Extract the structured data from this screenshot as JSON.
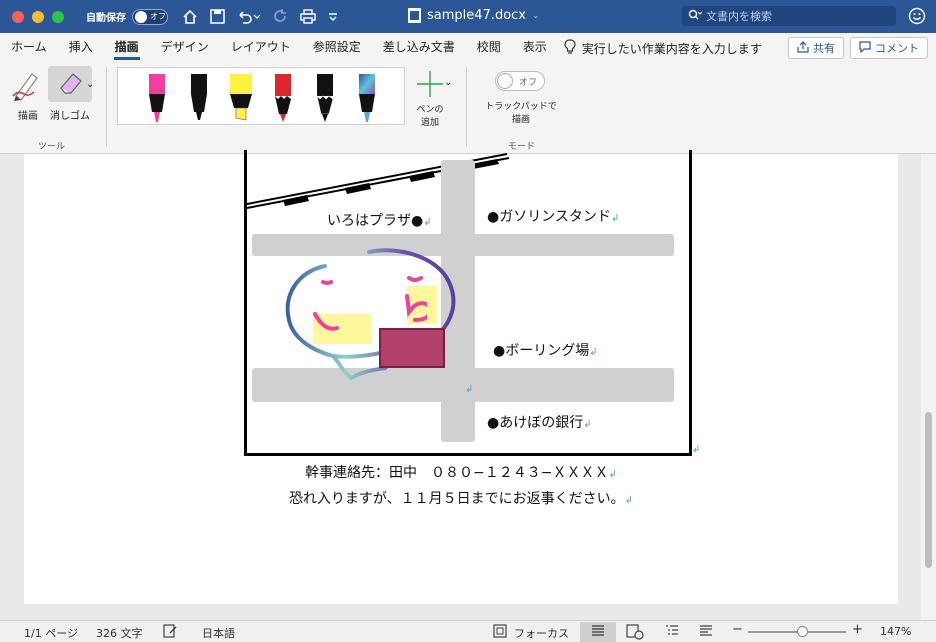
{
  "titlebar": {
    "autosave_label": "自動保存",
    "autosave_state": "オフ",
    "doc_name": "sample47.docx",
    "search_placeholder": "文書内を検索"
  },
  "tabs": [
    {
      "label": "ホーム"
    },
    {
      "label": "挿入"
    },
    {
      "label": "描画"
    },
    {
      "label": "デザイン"
    },
    {
      "label": "レイアウト"
    },
    {
      "label": "参照設定"
    },
    {
      "label": "差し込み文書"
    },
    {
      "label": "校閲"
    },
    {
      "label": "表示"
    }
  ],
  "tell_me": "実行したい作業内容を入力します",
  "share_label": "共有",
  "comment_label": "コメント",
  "ribbon": {
    "draw_label": "描画",
    "eraser_label": "消しゴム",
    "tools_group": "ツール",
    "add_pen_label1": "ペンの",
    "add_pen_label2": "追加",
    "mode_switch": "オフ",
    "mode_label1": "トラックパッドで",
    "mode_label2": "描画",
    "mode_group": "モード"
  },
  "pens": [
    {
      "color": "#f23ea0"
    },
    {
      "color": "#111111"
    },
    {
      "color": "#fff23c"
    },
    {
      "color": "#e0262d"
    },
    {
      "color": "#111111"
    },
    {
      "color": "#5aa7d6"
    }
  ],
  "map": {
    "place1": "いろはプラザ●",
    "place2": "●ガソリンスタンド",
    "place3": "●ボーリング場",
    "place4": "●あけぼの銀行",
    "return_mark": "↲"
  },
  "doc": {
    "line1": "幹事連絡先：田中　０８０−１２４３−ＸＸＸＸ",
    "line2": "恐れ入りますが、１１月５日までにお返事ください。"
  },
  "status": {
    "page": "1/1 ページ",
    "words": "326 文字",
    "language": "日本語",
    "focus": "フォーカス",
    "zoom": "147%"
  }
}
